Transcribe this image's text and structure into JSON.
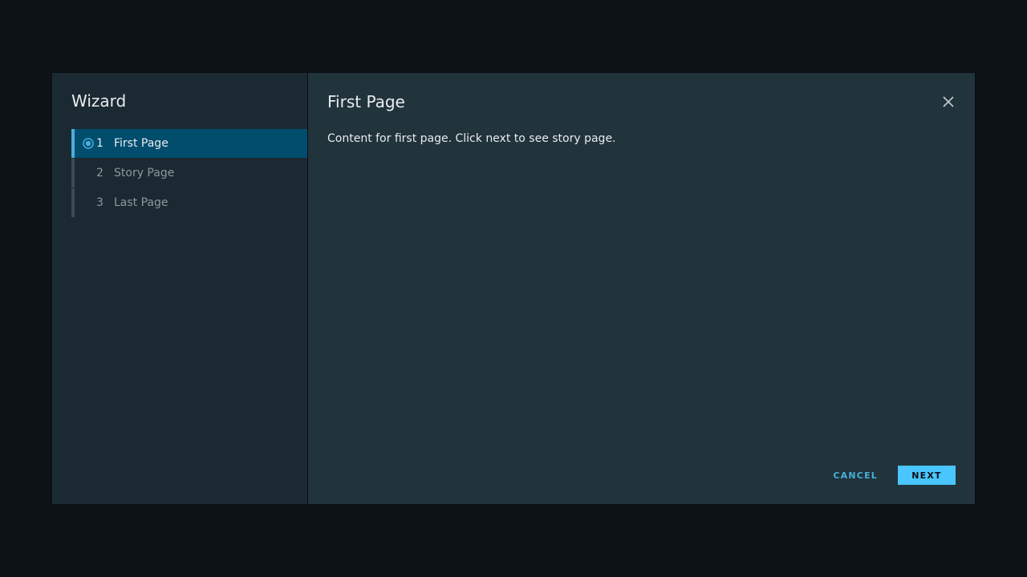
{
  "wizard": {
    "title": "Wizard",
    "steps": [
      {
        "number": "1",
        "label": "First Page",
        "active": true
      },
      {
        "number": "2",
        "label": "Story Page",
        "active": false
      },
      {
        "number": "3",
        "label": "Last Page",
        "active": false
      }
    ]
  },
  "page": {
    "title": "First Page",
    "content": "Content for first page. Click next to see story page."
  },
  "footer": {
    "cancel_label": "CANCEL",
    "next_label": "NEXT"
  },
  "icons": {
    "close": "close-icon",
    "step_current": "radio-dot-icon"
  },
  "colors": {
    "accent": "#49afd9",
    "primary_button": "#49c5ff",
    "active_step_bg": "#004d6e"
  }
}
